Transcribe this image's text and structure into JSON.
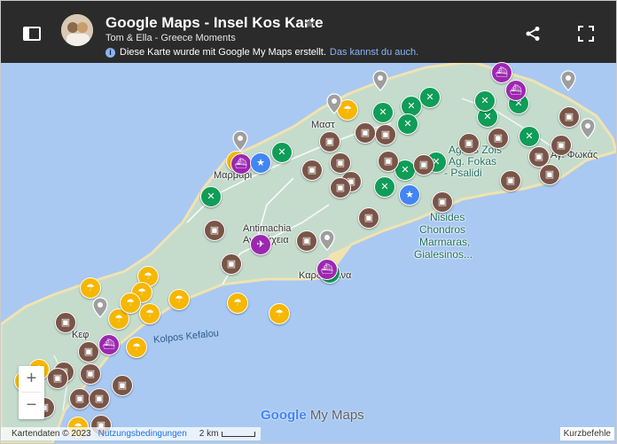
{
  "header": {
    "title": "Google Maps - Insel Kos Karte",
    "author": "Tom & Ella - Greece Moments",
    "notice_text": "Diese Karte wurde mit Google My Maps erstellt.",
    "notice_link": "Das kannst du auch."
  },
  "map": {
    "labels": {
      "nisides": "Nisides",
      "chondros": "Chondros",
      "marmaras": "Marmaras,",
      "gialesinos": "Gialesinos...",
      "kolpos": "Kolpos Kefalou",
      "antimachia_latin": "Antimachia",
      "antimachia_greek": "Αντιμάχεια",
      "kardamena": "Καρδάμαινα",
      "ag_fokas": "Αγ. Φωκάς",
      "agrias": "Agrias Zois",
      "fokas_psalidi": "Ag. Fokas",
      "psalidi": "- Psalidi",
      "kefalos_a": "Κεφ",
      "mastichari": "Μαστ",
      "marmari": "Μαρμάρι"
    },
    "watermark_google": "Google",
    "watermark_mymaps": "My Maps",
    "footer": {
      "data": "Kartendaten © 2023",
      "terms": "Nutzungsbedingungen",
      "scale": "2 km",
      "shortcuts": "Kurzbefehle"
    },
    "colors": {
      "water": "#a9c9f2",
      "land": "#c5dccd",
      "beach": "#f0e3b0",
      "restaurant": "#0f9d58",
      "sight": "#795548",
      "beach_marker": "#f6b701",
      "port": "#9c27b0",
      "airport_star": "#4285f4",
      "place_pin": "#9e9e9e"
    },
    "markers": [
      {
        "type": "restaurant",
        "icon": "cutlery-icon"
      },
      {
        "type": "sight",
        "icon": "landmark-icon"
      },
      {
        "type": "beach",
        "icon": "umbrella-icon"
      },
      {
        "type": "port",
        "icon": "ferry-icon"
      },
      {
        "type": "airport",
        "icon": "airplane-icon"
      },
      {
        "type": "star",
        "icon": "star-icon"
      },
      {
        "type": "place",
        "icon": "pin-icon"
      }
    ]
  }
}
